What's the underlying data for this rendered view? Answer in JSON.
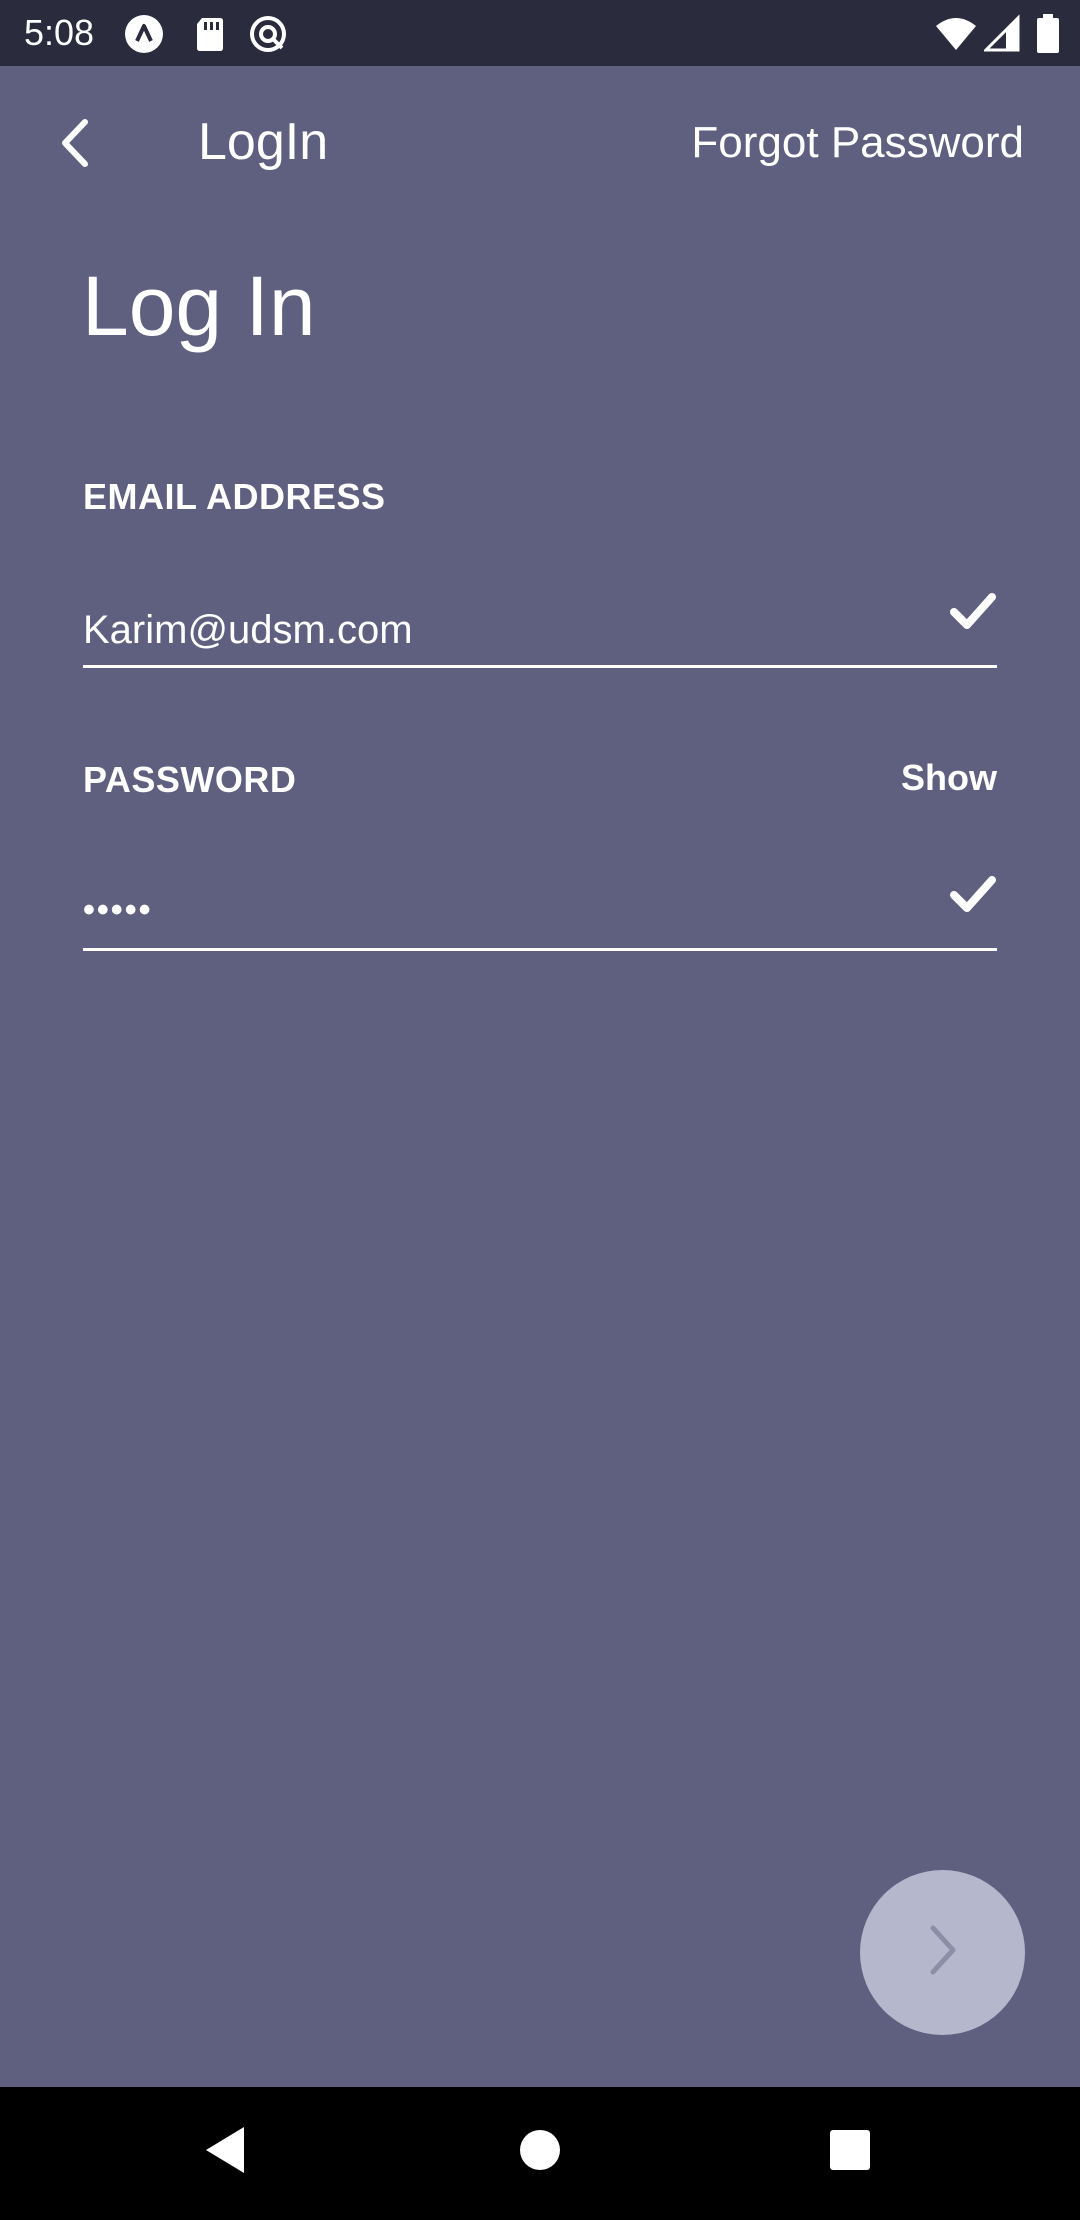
{
  "status_bar": {
    "time": "5:08",
    "left_icons": [
      "app-a-icon",
      "sd-card-icon",
      "at-sync-icon"
    ],
    "right_icons": [
      "wifi-icon",
      "signal-icon",
      "battery-icon"
    ]
  },
  "app_bar": {
    "title": "LogIn",
    "back_icon": "chevron-left-icon",
    "forgot_label": "Forgot Password"
  },
  "page": {
    "heading": "Log In"
  },
  "email": {
    "label": "EMAIL ADDRESS",
    "value": "Karim@udsm.com",
    "valid_icon": "check-icon"
  },
  "password": {
    "label": "PASSWORD",
    "toggle_label": "Show",
    "value": "•••••",
    "valid_icon": "check-icon"
  },
  "next_button": {
    "icon": "chevron-right-icon"
  },
  "nav_bar": {
    "icons": [
      "nav-back-icon",
      "nav-home-icon",
      "nav-recents-icon"
    ]
  },
  "colors": {
    "background": "#5f6080",
    "status_bar": "#2a2b3d",
    "next_button": "#b5b7cc",
    "next_chevron": "#8c8ea8",
    "nav_bar": "#000000"
  }
}
